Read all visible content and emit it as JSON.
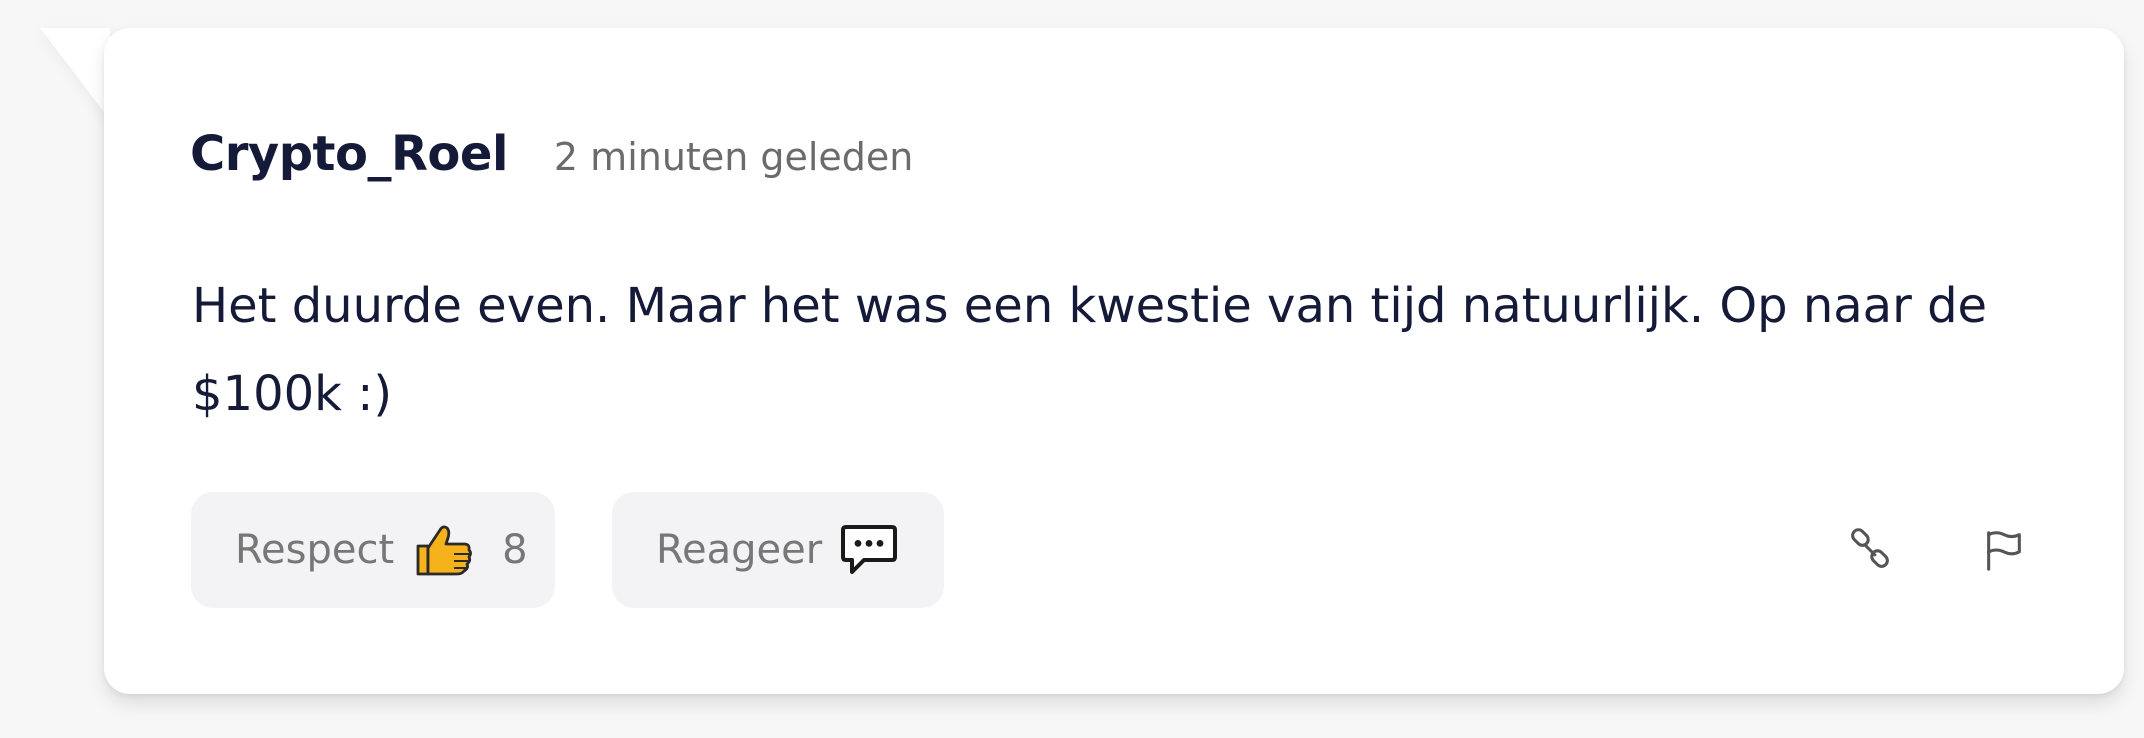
{
  "comment": {
    "author": "Crypto_Roel",
    "timestamp": "2 minuten geleden",
    "text": "Het duurde even. Maar het was een kwestie van tijd natuurlijk. Op naar de $100k :)"
  },
  "actions": {
    "respect_label": "Respect",
    "respect_icon": "thumbs-up-icon",
    "respect_count": "8",
    "reply_label": "Reageer",
    "reply_icon": "speech-bubble-icon",
    "link_icon": "link-icon",
    "flag_icon": "flag-icon"
  },
  "colors": {
    "text_dark": "#141a38",
    "muted": "#6b6b6b",
    "button_bg": "#f3f3f5",
    "thumb": "#f5b21a"
  }
}
